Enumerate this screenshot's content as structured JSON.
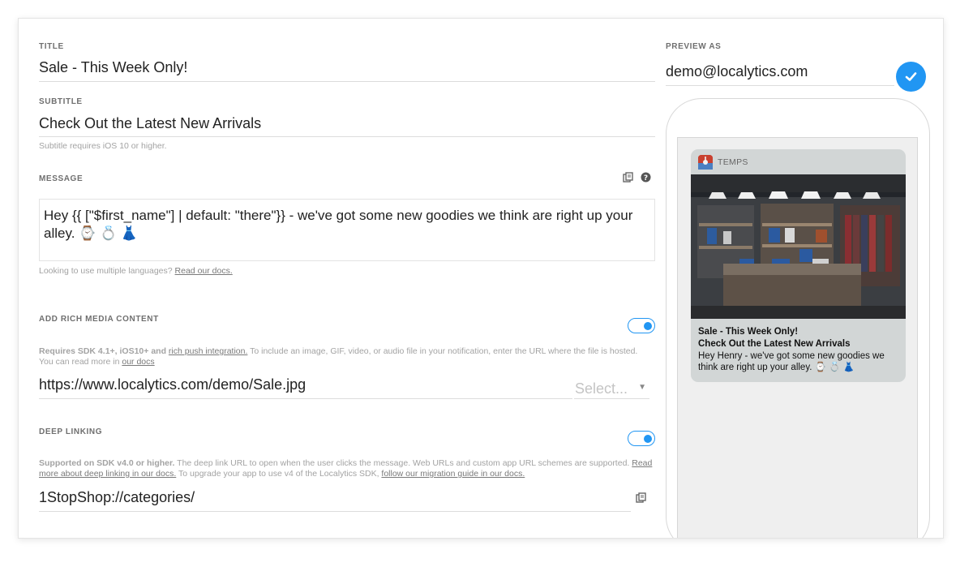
{
  "form": {
    "title_label": "TITLE",
    "title_value": "Sale - This Week Only!",
    "subtitle_label": "SUBTITLE",
    "subtitle_value": "Check Out the Latest New Arrivals",
    "subtitle_note": "Subtitle requires iOS 10 or higher.",
    "message_label": "MESSAGE",
    "message_value": "Hey {{ [\"$first_name\"] | default: \"there\"}} - we've got some new goodies we think are right up your alley. ⌚ 💍 👗",
    "message_note": "Looking to use multiple languages?",
    "message_note_link": "Read our docs.",
    "rich_media_label": "ADD RICH MEDIA CONTENT",
    "rich_media_enabled": true,
    "rich_media_note_bold": "Requires SDK 4.1+, iOS10+ and",
    "rich_media_note_link": "rich push integration.",
    "rich_media_note_text": "To include an image, GIF, video, or audio file in your notification, enter the URL where the file is hosted. You can read more in",
    "rich_media_note_link2": "our docs",
    "rich_media_url": "https://www.localytics.com/demo/Sale.jpg",
    "rich_media_select_placeholder": "Select...",
    "deep_link_label": "DEEP LINKING",
    "deep_link_enabled": true,
    "deep_link_note_bold": "Supported on SDK v4.0 or higher.",
    "deep_link_note_text": "The deep link URL to open when the user clicks the message. Web URLs and custom app URL schemes are supported.",
    "deep_link_note_link": "Read more about deep linking in our docs.",
    "deep_link_note_text2": "To upgrade your app to use v4 of the Localytics SDK,",
    "deep_link_note_link2": "follow our migration guide in our docs.",
    "deep_link_value": "1StopShop://categories/"
  },
  "preview": {
    "label": "PREVIEW AS",
    "email": "demo@localytics.com",
    "notification": {
      "app_name": "TEMPS",
      "title": "Sale - This Week Only!",
      "subtitle": "Check Out the Latest New Arrivals",
      "body": "Hey Henry - we've got some new goodies we think are right up your alley. ⌚ 💍 👗"
    }
  },
  "colors": {
    "accent": "#2196f3",
    "label_gray": "#6f6f6f",
    "note_gray": "#a3a3a3"
  },
  "icons": [
    "variables-icon",
    "help-icon",
    "check-icon",
    "chevron-down-icon",
    "app-icon",
    "product-image"
  ]
}
